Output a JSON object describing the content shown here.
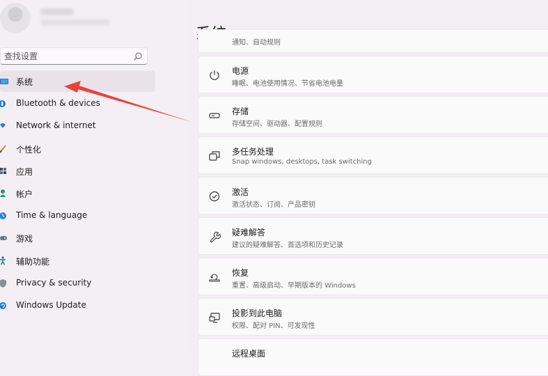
{
  "search": {
    "placeholder": "查找设置"
  },
  "nav": {
    "items": [
      {
        "label": "系统",
        "icon": "system-icon",
        "active": true
      },
      {
        "label": "Bluetooth & devices",
        "icon": "bluetooth-icon"
      },
      {
        "label": "Network & internet",
        "icon": "wifi-icon"
      },
      {
        "label": "个性化",
        "icon": "brush-icon"
      },
      {
        "label": "应用",
        "icon": "apps-icon"
      },
      {
        "label": "帐户",
        "icon": "account-icon"
      },
      {
        "label": "Time & language",
        "icon": "globe-clock-icon"
      },
      {
        "label": "游戏",
        "icon": "gamepad-icon"
      },
      {
        "label": "辅助功能",
        "icon": "accessibility-icon"
      },
      {
        "label": "Privacy & security",
        "icon": "shield-icon"
      },
      {
        "label": "Windows Update",
        "icon": "update-icon"
      }
    ]
  },
  "page": {
    "title": "系统"
  },
  "cards": [
    {
      "title": "",
      "subtitle": "通知、自动规则",
      "icon": "notification-icon"
    },
    {
      "title": "电源",
      "subtitle": "睡眠、电池使用情况、节省电池电量",
      "icon": "power-icon"
    },
    {
      "title": "存储",
      "subtitle": "存储空间、驱动器、配置规则",
      "icon": "storage-icon"
    },
    {
      "title": "多任务处理",
      "subtitle": "Snap windows, desktops, task switching",
      "icon": "multitasking-icon"
    },
    {
      "title": "激活",
      "subtitle": "激活状态、订阅、产品密钥",
      "icon": "activation-icon"
    },
    {
      "title": "疑难解答",
      "subtitle": "建议的疑难解答、首选项和历史记录",
      "icon": "wrench-icon"
    },
    {
      "title": "恢复",
      "subtitle": "重置、高级启动、早期版本的 Windows",
      "icon": "recovery-icon"
    },
    {
      "title": "投影到此电脑",
      "subtitle": "权限、配对 PIN、可发现性",
      "icon": "projection-icon"
    },
    {
      "title": "远程桌面",
      "subtitle": "",
      "icon": "remote-desktop-icon"
    }
  ]
}
